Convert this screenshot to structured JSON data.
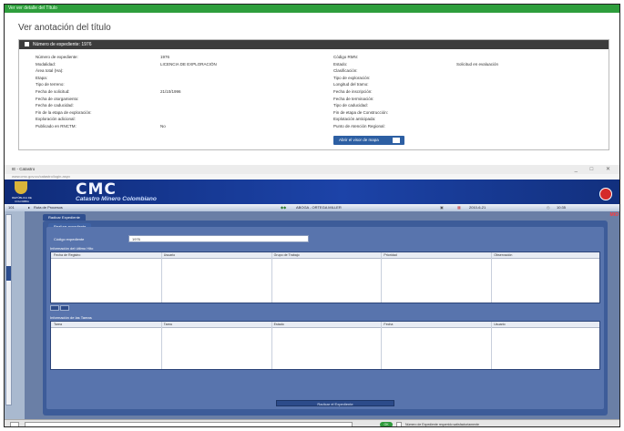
{
  "top": {
    "banner_text": "Ver ver detalle del Título",
    "page_title": "Ver anotación del título",
    "card_header": "Número de expediente: 1976",
    "left_fields": [
      {
        "label": "Número de expediente:",
        "value": "1976"
      },
      {
        "label": "Modalidad:",
        "value": "LICENCIA DE EXPLORACIÓN"
      },
      {
        "label": "Área total (Ha):",
        "value": ""
      },
      {
        "label": "Etapa:",
        "value": ""
      },
      {
        "label": "Tipo de terreno:",
        "value": ""
      },
      {
        "label": "Fecha de solicitud:",
        "value": "21/10/1996"
      },
      {
        "label": "Fecha de otorgamiento:",
        "value": ""
      },
      {
        "label": "Fecha de caducidad:",
        "value": ""
      },
      {
        "label": "Fin de la etapa de exploración:",
        "value": ""
      },
      {
        "label": "Exploración adicional:",
        "value": ""
      },
      {
        "label": "Publicado en RNCTM:",
        "value": "No"
      }
    ],
    "right_fields": [
      {
        "label": "Código RMN:",
        "value": ""
      },
      {
        "label": "Estado:",
        "value": "Solicitud en evaluación"
      },
      {
        "label": "Clasificación:",
        "value": ""
      },
      {
        "label": "Tipo de exploración:",
        "value": ""
      },
      {
        "label": "Longitud del tramo:",
        "value": ""
      },
      {
        "label": "Fecha de inscripción:",
        "value": ""
      },
      {
        "label": "Fecha de terminación:",
        "value": ""
      },
      {
        "label": "Tipo de caducidad:",
        "value": ""
      },
      {
        "label": "Fin de etapa de Construcción:",
        "value": ""
      },
      {
        "label": "Explotación anticipada:",
        "value": ""
      },
      {
        "label": "Punto de Atención Regional:",
        "value": ""
      }
    ],
    "map_button": "Abrir el visor de mapa"
  },
  "window": {
    "title": "IE - Catastro",
    "address": "www.cmc.gov.co/catastro/login.aspx",
    "controls": "_  □  ✕",
    "app_name": "CMC",
    "app_subtitle": "Catastro Minero Colombiano",
    "crest_text": "REPÚBLICA DE COLOMBIA",
    "toolbar_menu": "Ruta de Procesos",
    "toolbar_user": "ABOGA - ORTEGA MILLER",
    "toolbar_date": "2010-6-21",
    "toolbar_time": "10:35",
    "toolbar_num": "101",
    "topright": "MIO",
    "tab_outer": "Radicar Expediente",
    "tab_inner": "Realizar expediente",
    "field_label": "Código expediente",
    "field_value": "1976",
    "section1": "Información del último Hito",
    "grid1_cols": [
      "Fecha de Registro",
      "Usuario",
      "Grupo de Trabajo",
      "Prioridad",
      "Observación"
    ],
    "section2": "Información de las Tareas",
    "grid2_cols": [
      "Tarea",
      "Tarea",
      "Estado",
      "Fecha",
      "Usuario"
    ],
    "bottom_button": "Radicar el Expediente",
    "status_ok": "OK",
    "status_text": "Número de Expediente requerido satisfactoriamente"
  }
}
